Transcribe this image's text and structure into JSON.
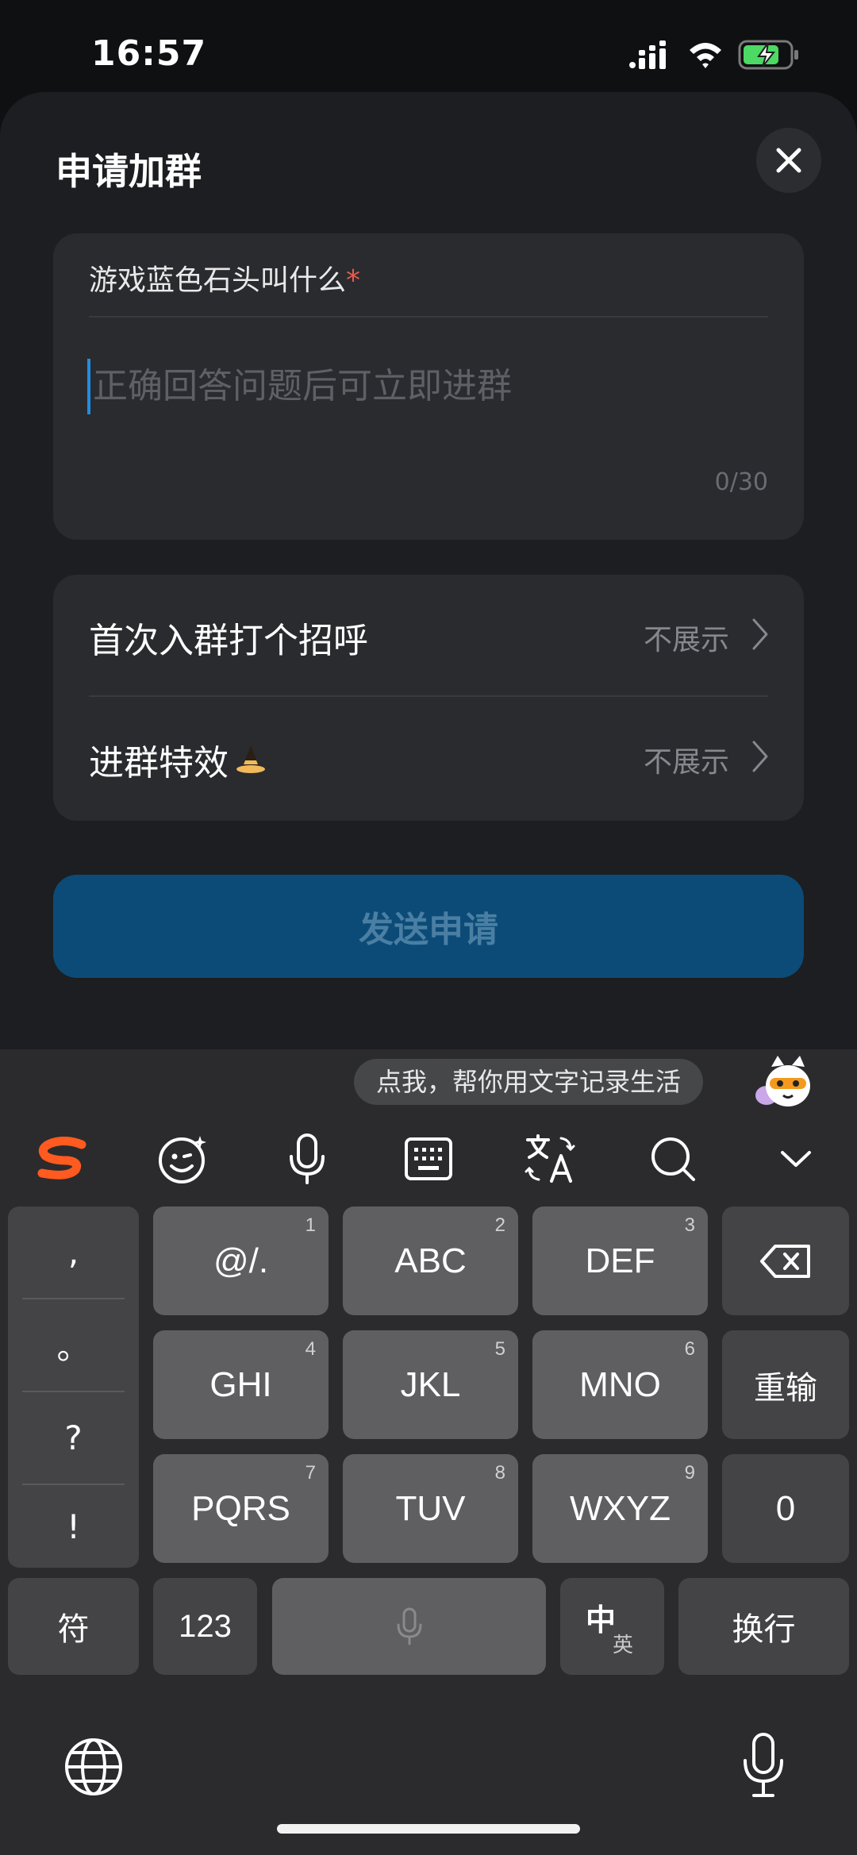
{
  "status": {
    "time": "16:57"
  },
  "sheet": {
    "title": "申请加群",
    "question": {
      "label": "游戏蓝色石头叫什么",
      "required_mark": "*",
      "placeholder": "正确回答问题后可立即进群",
      "counter": "0/30"
    },
    "settings": [
      {
        "label": "首次入群打个招呼",
        "value": "不展示"
      },
      {
        "label": "进群特效",
        "value": "不展示"
      }
    ],
    "submit_label": "发送申请"
  },
  "keyboard": {
    "suggestion": "点我，帮你用文字记录生活",
    "punctuation": [
      ",",
      "。",
      "?",
      "!"
    ],
    "keys": {
      "k1": {
        "label": "@/.",
        "num": "1"
      },
      "k2": {
        "label": "ABC",
        "num": "2"
      },
      "k3": {
        "label": "DEF",
        "num": "3"
      },
      "k4": {
        "label": "GHI",
        "num": "4"
      },
      "k5": {
        "label": "JKL",
        "num": "5"
      },
      "k6": {
        "label": "MNO",
        "num": "6"
      },
      "k7": {
        "label": "PQRS",
        "num": "7"
      },
      "k8": {
        "label": "TUV",
        "num": "8"
      },
      "k9": {
        "label": "WXYZ",
        "num": "9"
      },
      "reenter": "重输",
      "zero": "0",
      "symbols": "符",
      "numbers": "123",
      "lang_main": "中",
      "lang_sub": "英",
      "newline": "换行"
    }
  },
  "colors": {
    "accent": "#1f8ee0",
    "submit_bg": "#0c4b77",
    "required": "#e85a4f",
    "brand": "#ff5a1f"
  }
}
